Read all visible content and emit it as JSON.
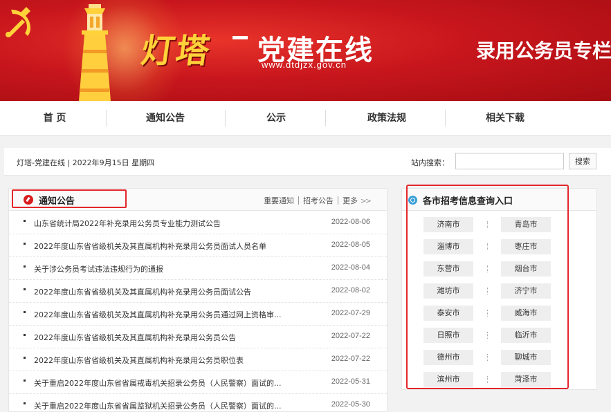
{
  "banner": {
    "logo_chars": "灯塔",
    "logo_name": "党建在线",
    "logo_url": "www.dtdjzx.gov.cn",
    "title": "录用公务员专栏",
    "icons": [
      "party-emblem-icon",
      "lighthouse-icon"
    ]
  },
  "nav": {
    "items": [
      {
        "label": "首  页"
      },
      {
        "label": "通知公告"
      },
      {
        "label": "公示"
      },
      {
        "label": "政策法规"
      },
      {
        "label": "相关下载"
      }
    ]
  },
  "infobar": {
    "breadcrumb": "灯塔-党建在线 | 2022年9月15日 星期四",
    "search_label": "站内搜索：",
    "search_value": "",
    "search_button": "搜索"
  },
  "notice": {
    "title": "通知公告",
    "links": [
      "重要通知",
      "招考公告",
      "更多"
    ],
    "items": [
      {
        "title": "山东省统计局2022年补充录用公务员专业能力测试公告",
        "date": "2022-08-06"
      },
      {
        "title": "2022年度山东省省级机关及其直属机构补充录用公务员面试人员名单",
        "date": "2022-08-05"
      },
      {
        "title": "关于涉公务员考试违法违规行为的通报",
        "date": "2022-08-04"
      },
      {
        "title": "2022年度山东省省级机关及其直属机构补充录用公务员面试公告",
        "date": "2022-08-02"
      },
      {
        "title": "2022年度山东省省级机关及其直属机构补充录用公务员通过网上资格审...",
        "date": "2022-07-29"
      },
      {
        "title": "2022年度山东省省级机关及其直属机构补充录用公务员公告",
        "date": "2022-07-22"
      },
      {
        "title": "2022年度山东省省级机关及其直属机构补充录用公务员职位表",
        "date": "2022-07-22"
      },
      {
        "title": "关于重启2022年度山东省省属戒毒机关招录公务员（人民警察）面试的...",
        "date": "2022-05-31"
      },
      {
        "title": "关于重启2022年度山东省省属监狱机关招录公务员（人民警察）面试的...",
        "date": "2022-05-30"
      }
    ]
  },
  "cities": {
    "title": "各市招考信息查询入口",
    "rows": [
      [
        "济南市",
        "青岛市"
      ],
      [
        "淄博市",
        "枣庄市"
      ],
      [
        "东营市",
        "烟台市"
      ],
      [
        "潍坊市",
        "济宁市"
      ],
      [
        "泰安市",
        "威海市"
      ],
      [
        "日照市",
        "临沂市"
      ],
      [
        "德州市",
        "聊城市"
      ],
      [
        "滨州市",
        "菏泽市"
      ]
    ]
  },
  "colors": {
    "brand_red": "#c8161d",
    "highlight_red": "#e3262b",
    "logo_gold": "#ffd23a",
    "search_icon_blue": "#3aa0d8"
  }
}
